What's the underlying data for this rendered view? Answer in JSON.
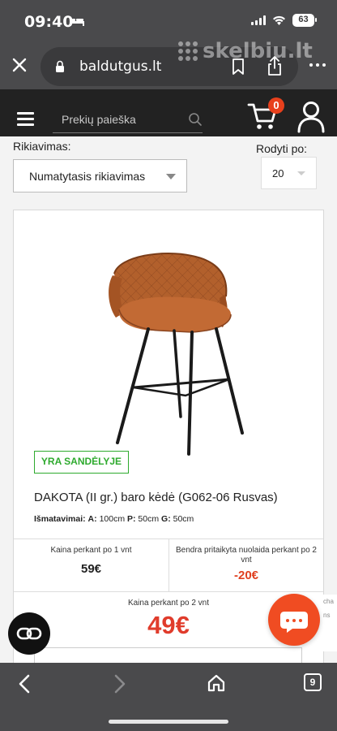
{
  "status_bar": {
    "time": "09:40",
    "battery": "63"
  },
  "browser": {
    "url": "baldutgus.lt",
    "watermark": "skelbiu.lt",
    "tab_count": "9"
  },
  "header": {
    "search_placeholder": "Prekių paieška",
    "cart_count": "0"
  },
  "sort": {
    "label": "Rikiavimas:",
    "value": "Numatytasis rikiavimas"
  },
  "show": {
    "label": "Rodyti po:",
    "value": "20"
  },
  "product": {
    "stock_badge": "YRA SANDĖLYJE",
    "title": "DAKOTA (II gr.) baro kėdė (G062-06 Rusvas)",
    "dims_label": "Išmatavimai:",
    "dims": [
      {
        "k": "A:",
        "v": "100cm"
      },
      {
        "k": "P:",
        "v": "50cm"
      },
      {
        "k": "G:",
        "v": "50cm"
      }
    ],
    "price_one_label": "Kaina perkant po 1 vnt",
    "price_one": "59€",
    "discount_label": "Bendra pritaikyta nuolaida perkant po 2 vnt",
    "discount": "-20€",
    "price_two_label": "Kaina perkant po 2 vnt",
    "price_two": "49€",
    "image_colors": {
      "seat": "#b05a2a",
      "legs": "#1a1a1a"
    }
  },
  "side_strip": {
    "line1": "cha",
    "line2": "ns"
  },
  "colors": {
    "accent": "#e8401c",
    "stock_green": "#2eaa2e",
    "price_red": "#e03c2c",
    "header_dark": "#222222",
    "chrome": "#4a4a4c"
  }
}
